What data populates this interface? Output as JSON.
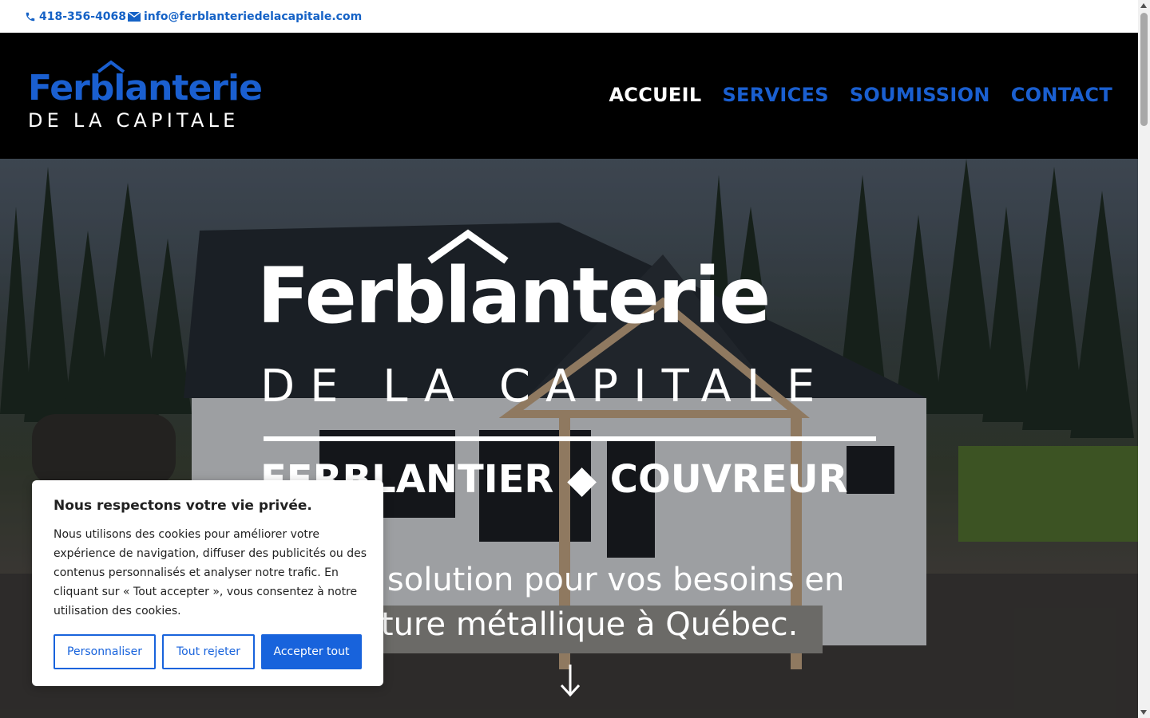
{
  "topbar": {
    "phone": "418-356-4068",
    "email": "info@ferblanteriedelacapitale.com",
    "phone_icon": "phone-icon",
    "email_icon": "envelope-icon"
  },
  "header": {
    "logo": {
      "brand": "Ferblanterie",
      "sub": "DE LA CAPITALE"
    },
    "nav": [
      {
        "label": "ACCUEIL",
        "active": true
      },
      {
        "label": "SERVICES",
        "active": false
      },
      {
        "label": "SOUMISSION",
        "active": false
      },
      {
        "label": "CONTACT",
        "active": false
      }
    ]
  },
  "hero": {
    "brand": "Ferblanterie",
    "sub": "DE LA CAPITALE",
    "tagline": "FERBLANTIER ◆ COUVREUR",
    "lead_line1": "Votre solution pour vos besoins en",
    "lead_line2": "toiture métallique à Québec.",
    "scroll_icon": "arrow-down-icon"
  },
  "cookie": {
    "title": "Nous respectons votre vie privée.",
    "body": "Nous utilisons des cookies pour améliorer votre expérience de navigation, diffuser des publicités ou des contenus personnalisés et analyser notre trafic. En cliquant sur « Tout accepter », vous consentez à notre utilisation des cookies.",
    "customize": "Personnaliser",
    "reject": "Tout rejeter",
    "accept": "Accepter tout"
  },
  "colors": {
    "brand_blue": "#1a5fd0",
    "link_blue": "#1562c6",
    "cookie_blue": "#1863dc",
    "header_bg": "#000000"
  }
}
